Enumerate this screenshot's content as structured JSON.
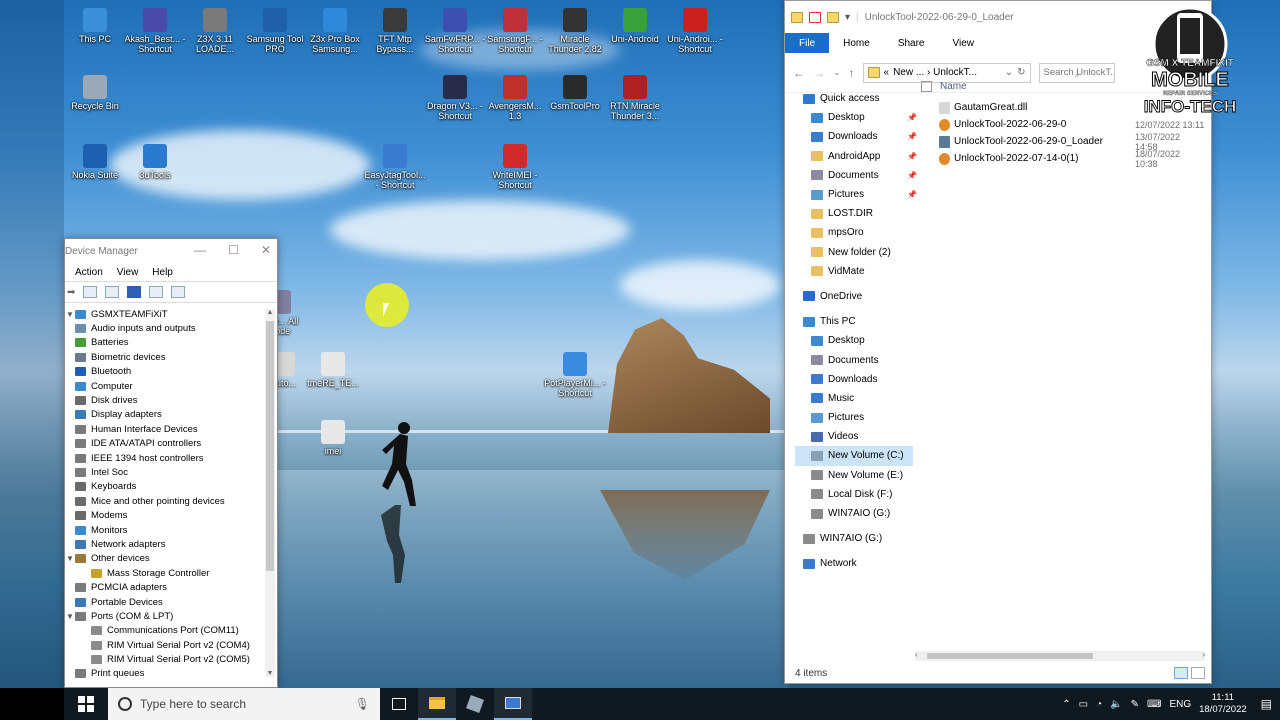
{
  "desktop": {
    "icons": [
      {
        "label": "This PC",
        "icon": "pc-icon",
        "color": "#3b8fd9"
      },
      {
        "label": "Akash_Best... - Shortcut",
        "icon": "tool-icon",
        "color": "#4a4aa8"
      },
      {
        "label": "Z3X 3.11 LOADE...",
        "icon": "z3x-icon",
        "color": "#7a7a7a"
      },
      {
        "label": "Samsung Tool PRO",
        "icon": "gear-icon",
        "color": "#1f5fa8"
      },
      {
        "label": "Z3x Pro Box Samsung...",
        "icon": "z3x-icon",
        "color": "#2e8ad8"
      },
      {
        "label": "TFT Mtp Bypass...",
        "icon": "tft-icon",
        "color": "#3a3a3a"
      },
      {
        "label": "SamFwFRP... - Shortcut",
        "icon": "gear-icon",
        "color": "#3d4fb0"
      },
      {
        "label": "SamsungF... - Shortcut",
        "icon": "phone-icon",
        "color": "#c0303a"
      },
      {
        "label": "Miracle Thunder 2.82",
        "icon": "thunder-icon",
        "color": "#333333"
      },
      {
        "label": "Uni-Android",
        "icon": "android-icon",
        "color": "#3aa03a"
      },
      {
        "label": "Uni-Androi... - Shortcut",
        "icon": "android-icon",
        "color": "#cc2020"
      },
      {
        "label": "Recycle Bin",
        "icon": "recycle-bin-icon",
        "color": "#9aa8b8"
      },
      {
        "label": "Dragon V3... - Shortcut",
        "icon": "dragon-icon",
        "color": "#2a2a4a"
      },
      {
        "label": "AvengersM... 1.3",
        "icon": "avengers-icon",
        "color": "#c0302a"
      },
      {
        "label": "GsmToolPro",
        "icon": "tool-icon",
        "color": "#2a2a2a"
      },
      {
        "label": "RTN Miracle Thunder 3...",
        "icon": "thunder-icon",
        "color": "#b02020"
      },
      {
        "label": "Nokia Suite",
        "icon": "nokia-icon",
        "color": "#1f5fb0"
      },
      {
        "label": "3uTools",
        "icon": "3utools-icon",
        "color": "#2a7ad0"
      },
      {
        "label": "EasyJtagTool... - Shortcut",
        "icon": "jtag-icon",
        "color": "#3a7ad0"
      },
      {
        "label": "WriteIMEI - Shortcut",
        "icon": "imei-icon",
        "color": "#d02a2a"
      },
      {
        "label": "Ultra... All Mode",
        "icon": "tool-icon",
        "color": "#8080a0"
      },
      {
        "label": "Auto...",
        "icon": "file-icon",
        "color": "#d8d8d8"
      },
      {
        "label": "tmeRE_TE...",
        "icon": "file-icon",
        "color": "#e8e8e8"
      },
      {
        "label": "imei",
        "icon": "file-icon",
        "color": "#e8e8e8"
      },
      {
        "label": "PotPlayerMi... - Shortcut",
        "icon": "play-icon",
        "color": "#3a8ae0"
      }
    ]
  },
  "device_manager": {
    "title": "Device Manager",
    "menu": [
      "Action",
      "View",
      "Help"
    ],
    "root": "GSMXTEAMFiXiT",
    "items": [
      {
        "label": "Audio inputs and outputs",
        "color": "#6c8fb0",
        "expanded": false,
        "indent": 1
      },
      {
        "label": "Batteries",
        "color": "#4a9a3a",
        "expanded": false,
        "indent": 1
      },
      {
        "label": "Biometric devices",
        "color": "#6a7a8a",
        "expanded": false,
        "indent": 1
      },
      {
        "label": "Bluetooth",
        "color": "#1f5fb0",
        "expanded": false,
        "indent": 1
      },
      {
        "label": "Computer",
        "color": "#3a8ad0",
        "expanded": false,
        "indent": 1
      },
      {
        "label": "Disk drives",
        "color": "#6a6a6a",
        "expanded": false,
        "indent": 1
      },
      {
        "label": "Display adapters",
        "color": "#3a7ab0",
        "expanded": false,
        "indent": 1
      },
      {
        "label": "Human Interface Devices",
        "color": "#7a7a7a",
        "expanded": false,
        "indent": 1
      },
      {
        "label": "IDE ATA/ATAPI controllers",
        "color": "#7a7a7a",
        "expanded": false,
        "indent": 1
      },
      {
        "label": "IEEE 1394 host controllers",
        "color": "#7a7a7a",
        "expanded": false,
        "indent": 1
      },
      {
        "label": "Intel Soc",
        "color": "#7a7a7a",
        "expanded": false,
        "indent": 1
      },
      {
        "label": "Keyboards",
        "color": "#6a6a6a",
        "expanded": false,
        "indent": 1
      },
      {
        "label": "Mice and other pointing devices",
        "color": "#6a6a6a",
        "expanded": false,
        "indent": 1
      },
      {
        "label": "Modems",
        "color": "#6a6a6a",
        "expanded": false,
        "indent": 1
      },
      {
        "label": "Monitors",
        "color": "#3a8ad0",
        "expanded": false,
        "indent": 1
      },
      {
        "label": "Network adapters",
        "color": "#3a7ab0",
        "expanded": false,
        "indent": 1
      },
      {
        "label": "Other devices",
        "color": "#9a7a3a",
        "expanded": true,
        "indent": 1
      },
      {
        "label": "Mass Storage Controller",
        "color": "#c8a030",
        "expanded": false,
        "indent": 2
      },
      {
        "label": "PCMCIA adapters",
        "color": "#7a7a7a",
        "expanded": false,
        "indent": 1
      },
      {
        "label": "Portable Devices",
        "color": "#3a7ab0",
        "expanded": false,
        "indent": 1
      },
      {
        "label": "Ports (COM & LPT)",
        "color": "#7a7a7a",
        "expanded": true,
        "indent": 1
      },
      {
        "label": "Communications Port (COM11)",
        "color": "#8a8a8a",
        "expanded": false,
        "indent": 2
      },
      {
        "label": "RIM Virtual Serial Port v2 (COM4)",
        "color": "#8a8a8a",
        "expanded": false,
        "indent": 2
      },
      {
        "label": "RIM Virtual Serial Port v2 (COM5)",
        "color": "#8a8a8a",
        "expanded": false,
        "indent": 2
      },
      {
        "label": "Print queues",
        "color": "#7a7a7a",
        "expanded": false,
        "indent": 1
      }
    ]
  },
  "explorer": {
    "title": "UnlockTool-2022-06-29-0_Loader",
    "tabs": [
      "File",
      "Home",
      "Share",
      "View"
    ],
    "address": "New ...  ›  UnlockT...",
    "address_prefix": "«",
    "search_placeholder": "Search UnlockT...",
    "column_name": "Name",
    "nav": [
      {
        "label": "Quick access",
        "color": "#2a7ad0",
        "level": 0,
        "pinned": false,
        "selected": false
      },
      {
        "label": "Desktop",
        "color": "#3a8ad0",
        "level": 1,
        "pinned": true,
        "selected": false
      },
      {
        "label": "Downloads",
        "color": "#3a7ad0",
        "level": 1,
        "pinned": true,
        "selected": false
      },
      {
        "label": "AndroidApp",
        "color": "#e8c060",
        "level": 1,
        "pinned": true,
        "selected": false
      },
      {
        "label": "Documents",
        "color": "#8a8aa0",
        "level": 1,
        "pinned": true,
        "selected": false
      },
      {
        "label": "Pictures",
        "color": "#5a9ad0",
        "level": 1,
        "pinned": true,
        "selected": false
      },
      {
        "label": "LOST.DIR",
        "color": "#e8c060",
        "level": 1,
        "pinned": false,
        "selected": false
      },
      {
        "label": "mpsOro",
        "color": "#e8c060",
        "level": 1,
        "pinned": false,
        "selected": false
      },
      {
        "label": "New folder (2)",
        "color": "#e8c060",
        "level": 1,
        "pinned": false,
        "selected": false
      },
      {
        "label": "VidMate",
        "color": "#e8c060",
        "level": 1,
        "pinned": false,
        "selected": false
      },
      {
        "label": "OneDrive",
        "color": "#2a6ad0",
        "level": 0,
        "pinned": false,
        "selected": false
      },
      {
        "label": "This PC",
        "color": "#3a8ad0",
        "level": 0,
        "pinned": false,
        "selected": false
      },
      {
        "label": "Desktop",
        "color": "#3a8ad0",
        "level": 1,
        "pinned": false,
        "selected": false
      },
      {
        "label": "Documents",
        "color": "#8a8aa0",
        "level": 1,
        "pinned": false,
        "selected": false
      },
      {
        "label": "Downloads",
        "color": "#3a7ad0",
        "level": 1,
        "pinned": false,
        "selected": false
      },
      {
        "label": "Music",
        "color": "#3a7ad0",
        "level": 1,
        "pinned": false,
        "selected": false
      },
      {
        "label": "Pictures",
        "color": "#5a9ad0",
        "level": 1,
        "pinned": false,
        "selected": false
      },
      {
        "label": "Videos",
        "color": "#4a6ab0",
        "level": 1,
        "pinned": false,
        "selected": false
      },
      {
        "label": "New Volume (C:)",
        "color": "#8aa0b8",
        "level": 1,
        "pinned": false,
        "selected": true
      },
      {
        "label": "New Volume  (E:)",
        "color": "#8a8a8a",
        "level": 1,
        "pinned": false,
        "selected": false
      },
      {
        "label": "Local Disk (F:)",
        "color": "#8a8a8a",
        "level": 1,
        "pinned": false,
        "selected": false
      },
      {
        "label": "WIN7AIO (G:)",
        "color": "#8a8a8a",
        "level": 1,
        "pinned": false,
        "selected": false
      },
      {
        "label": "WIN7AIO (G:)",
        "color": "#8a8a8a",
        "level": 0,
        "pinned": false,
        "selected": false
      },
      {
        "label": "Network",
        "color": "#3a7ad0",
        "level": 0,
        "pinned": false,
        "selected": false
      }
    ],
    "files": [
      {
        "name": "GautamGreat.dll",
        "date": "",
        "icon": "dll-icon",
        "color": "#d8d8d8"
      },
      {
        "name": "UnlockTool-2022-06-29-0",
        "date": "12/07/2022 13:11",
        "icon": "app-icon",
        "color": "#e08a2a"
      },
      {
        "name": "UnlockTool-2022-06-29-0_Loader",
        "date": "13/07/2022 14:58",
        "icon": "exe-icon",
        "color": "#5a7a9a"
      },
      {
        "name": "UnlockTool-2022-07-14-0(1)",
        "date": "18/07/2022 10:38",
        "icon": "app-icon",
        "color": "#e08a2a"
      }
    ],
    "status": "4 items"
  },
  "watermark": {
    "line1": "GSM X TEAMFIXIT",
    "line2": "MOBILE",
    "line3": "REPAIR SERVICES",
    "line4": "INFO-TECH"
  },
  "taskbar": {
    "search_placeholder": "Type here to search",
    "language": "ENG",
    "time": "11:11",
    "date": "18/07/2022"
  }
}
